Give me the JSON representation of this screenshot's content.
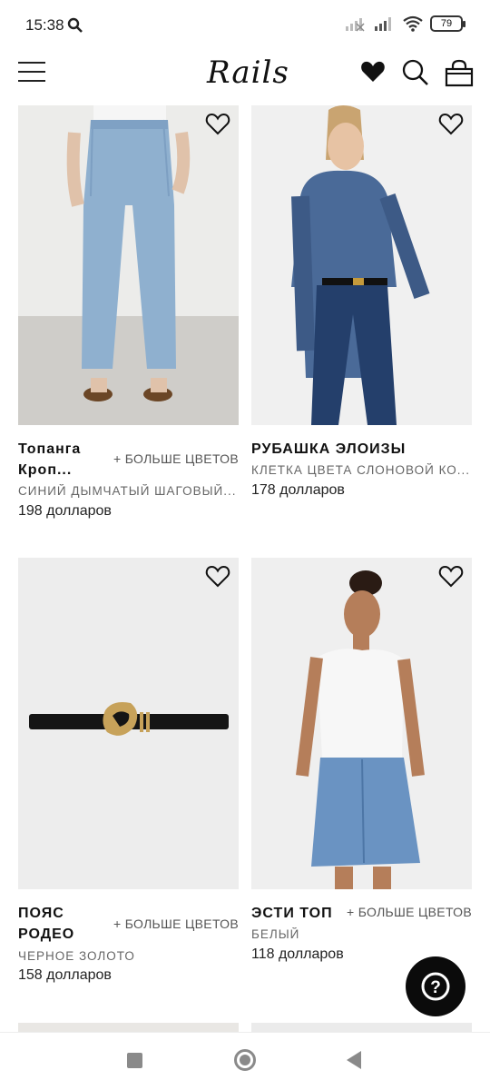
{
  "status_bar": {
    "time": "15:38",
    "battery": "79"
  },
  "header": {
    "logo": "Rails"
  },
  "products": [
    {
      "name_line1": "Топанга",
      "name_line2": "Кроп...",
      "more_colors": "+ БОЛЬШЕ ЦВЕТОВ",
      "color": "СИНИЙ ДЫМЧАТЫЙ ШАГОВЫЙ...",
      "price": "198 долларов"
    },
    {
      "name_line1": "РУБАШКА ЭЛОИЗЫ",
      "name_line2": "",
      "more_colors": "",
      "color": "КЛЕТКА ЦВЕТА СЛОНОВОЙ КО...",
      "price": "178 долларов"
    },
    {
      "name_line1": "ПОЯС",
      "name_line2": "РОДЕО",
      "more_colors": "+ БОЛЬШЕ ЦВЕТОВ",
      "color": "ЧЕРНОЕ ЗОЛОТО",
      "price": "158 долларов"
    },
    {
      "name_line1": "ЭСТИ ТОП",
      "name_line2": "",
      "more_colors": "+ БОЛЬШЕ ЦВЕТОВ",
      "color": "БЕЛЫЙ",
      "price": "118 долларов"
    }
  ],
  "help_button": {
    "label": "?"
  },
  "colors": {
    "accent": "#0b0b0b",
    "denim": "#8fb0cf",
    "shirt": "#4a6a98"
  }
}
